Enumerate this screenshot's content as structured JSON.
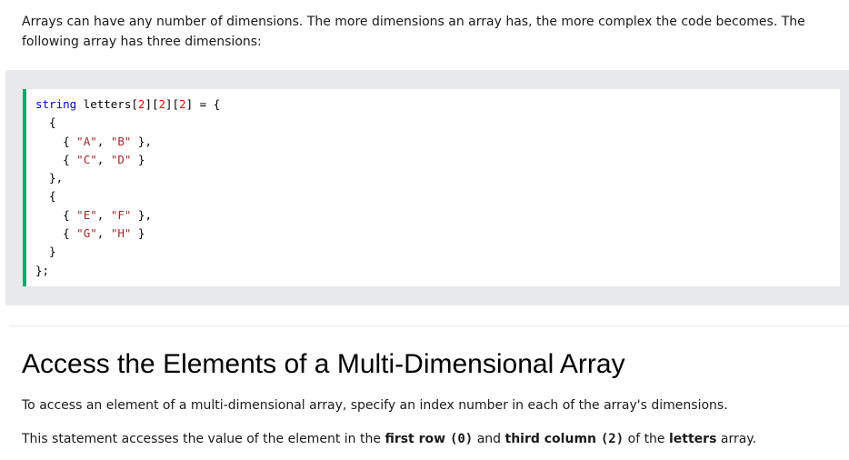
{
  "intro": {
    "text": "Arrays can have any number of dimensions. The more dimensions an array has, the more complex the code becomes. The following array has three dimensions:"
  },
  "code_example": {
    "accent_color": "#04aa6d",
    "lines": [
      {
        "type": "string",
        "name": " letters",
        "dims": [
          "2",
          "2",
          "2"
        ],
        "rest": " = {"
      },
      {
        "text": "  {"
      },
      {
        "indent": "    ",
        "a": "\"A\"",
        "b": "\"B\"",
        "tail": " },"
      },
      {
        "indent": "    ",
        "a": "\"C\"",
        "b": "\"D\"",
        "tail": " }"
      },
      {
        "text": "  },"
      },
      {
        "text": "  {"
      },
      {
        "indent": "    ",
        "a": "\"E\"",
        "b": "\"F\"",
        "tail": " },"
      },
      {
        "indent": "    ",
        "a": "\"G\"",
        "b": "\"H\"",
        "tail": " }"
      },
      {
        "text": "  }"
      },
      {
        "text": "};"
      }
    ]
  },
  "section": {
    "heading": "Access the Elements of a Multi-Dimensional Array",
    "paragraph1": "To access an element of a multi-dimensional array, specify an index number in each of the array's dimensions.",
    "paragraph2": {
      "part1": "This statement accesses the value of the element in the ",
      "bold1_text": "first row ",
      "bold1_code": "(0)",
      "part2": " and ",
      "bold2_text": "third column ",
      "bold2_code": "(2)",
      "part3": " of the ",
      "bold3": "letters",
      "part4": " array."
    }
  }
}
